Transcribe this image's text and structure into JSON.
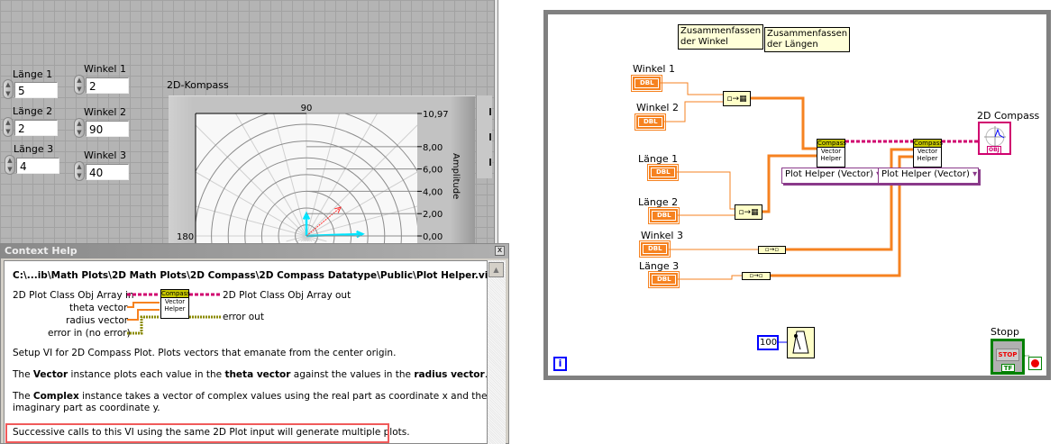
{
  "front_panel": {
    "controls": [
      {
        "label": "Länge 1",
        "value": "5"
      },
      {
        "label": "Winkel 1",
        "value": "2"
      },
      {
        "label": "Länge 2",
        "value": "2"
      },
      {
        "label": "Winkel 2",
        "value": "90"
      },
      {
        "label": "Länge 3",
        "value": "4"
      },
      {
        "label": "Winkel 3",
        "value": "40"
      }
    ],
    "graph_label": "2D-Kompass",
    "chart_data": {
      "type": "compass",
      "angle_labels": {
        "top": "90",
        "left": "180"
      },
      "ylabel": "Amplitude",
      "yticks": [
        "10,97",
        "8,00",
        "6,00",
        "4,00",
        "2,00",
        "0,00"
      ],
      "ylim": [
        0,
        10.97
      ],
      "vectors": [
        {
          "angle": 2,
          "length": 5,
          "color": "#00e5ff"
        },
        {
          "angle": 90,
          "length": 2,
          "color": "#00e5ff"
        },
        {
          "angle": 40,
          "length": 4,
          "color": "#ff3030"
        }
      ]
    }
  },
  "context_help": {
    "title": "Context Help",
    "close": "x",
    "path": "C:\\...ib\\Math Plots\\2D Math Plots\\2D Compass\\2D Compass Datatype\\Public\\Plot Helper.vi",
    "terminals": {
      "in1": "2D Plot Class Obj Array in",
      "in2": "theta vector",
      "in3": "radius vector",
      "in4": "error in (no error)",
      "out1": "2D Plot Class Obj Array out",
      "out2": "error out"
    },
    "icon": {
      "top": "Compass",
      "line1": "Vector",
      "line2": "Helper"
    },
    "p1": "Setup VI for 2D Compass Plot. Plots vectors that emanate from the center origin.",
    "p2": {
      "a": "The ",
      "b": "Vector",
      "c": " instance plots each value in the ",
      "d": "theta vector",
      "e": " against the values in the ",
      "f": "radius vector",
      "g": "."
    },
    "p3": {
      "a": "The ",
      "b": "Complex",
      "c": " instance takes a vector of complex values using the real part as coordinate x and the",
      "d": "imaginary part as coordinate y."
    },
    "p4": "Successive calls to this VI using the same 2D Plot input will generate multiple plots."
  },
  "block_diagram": {
    "notes": [
      {
        "l1": "Zusammenfassen",
        "l2": "der Winkel"
      },
      {
        "l1": "Zusammenfassen",
        "l2": "der Längen"
      }
    ],
    "terminals": [
      "Winkel 1",
      "Winkel 2",
      "Länge 1",
      "Länge 2",
      "Winkel 3",
      "Länge 3"
    ],
    "dbl": "DBL",
    "vi": {
      "top": "Compass",
      "l1": "Vector",
      "l2": "Helper"
    },
    "selector": "Plot Helper (Vector)",
    "indicator_label": "2D Compass",
    "indicator_tag": "OBJ",
    "wait_const": "100",
    "stop_label": "Stopp",
    "stop_btn": "STOP",
    "stop_tf": "TF",
    "loop_i": "i"
  }
}
